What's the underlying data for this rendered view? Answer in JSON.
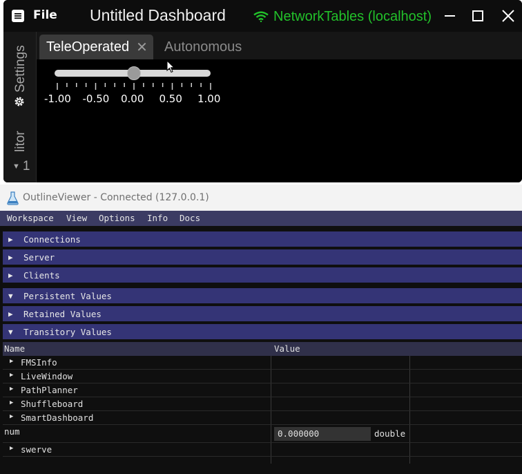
{
  "shuffleboard": {
    "menu": {
      "file_label": "File",
      "menu_icon": "hamburger-menu-icon"
    },
    "title": "Untitled Dashboard",
    "nt_status": {
      "label": "NetworkTables (localhost)",
      "icon": "wifi-icon",
      "color": "#22c02a"
    },
    "window_controls": {
      "minimize_icon": "minimize-icon",
      "maximize_icon": "maximize-icon",
      "close_icon": "close-icon"
    },
    "sidebar": {
      "settings_label": "Settings",
      "settings_icon": "gear-icon",
      "editor_label": "litor",
      "layout_value": "1"
    },
    "tabs": [
      {
        "label": "TeleOperated",
        "active": true,
        "close_glyph": "✕"
      },
      {
        "label": "Autonomous",
        "active": false
      }
    ],
    "slider": {
      "min": -1.0,
      "max": 1.0,
      "value": 0.0,
      "tick_labels": [
        "-1.00",
        "-0.50",
        "0.00",
        "0.50",
        "1.00"
      ]
    }
  },
  "outline_viewer": {
    "title": "OutlineViewer - Connected (127.0.0.1)",
    "app_icon": "flask-icon",
    "menu": [
      "Workspace",
      "View",
      "Options",
      "Info",
      "Docs"
    ],
    "sections": [
      {
        "label": "Connections",
        "expanded": false
      },
      {
        "label": "Server",
        "expanded": false
      },
      {
        "label": "Clients",
        "expanded": false
      },
      {
        "label": "Persistent Values",
        "expanded": true
      },
      {
        "label": "Retained Values",
        "expanded": false
      },
      {
        "label": "Transitory Values",
        "expanded": true
      }
    ],
    "table": {
      "columns": {
        "name": "Name",
        "value": "Value"
      },
      "rows": [
        {
          "name": "FMSInfo",
          "expandable": true
        },
        {
          "name": "LiveWindow",
          "expandable": true
        },
        {
          "name": "PathPlanner",
          "expandable": true
        },
        {
          "name": "Shuffleboard",
          "expandable": true
        },
        {
          "name": "SmartDashboard",
          "expandable": true
        },
        {
          "name": "num",
          "expandable": false,
          "value": "0.000000",
          "type": "double"
        },
        {
          "name": "swerve",
          "expandable": true
        }
      ]
    },
    "colors": {
      "section_bg": "#343476",
      "menubar_bg": "#3b3b63"
    }
  }
}
